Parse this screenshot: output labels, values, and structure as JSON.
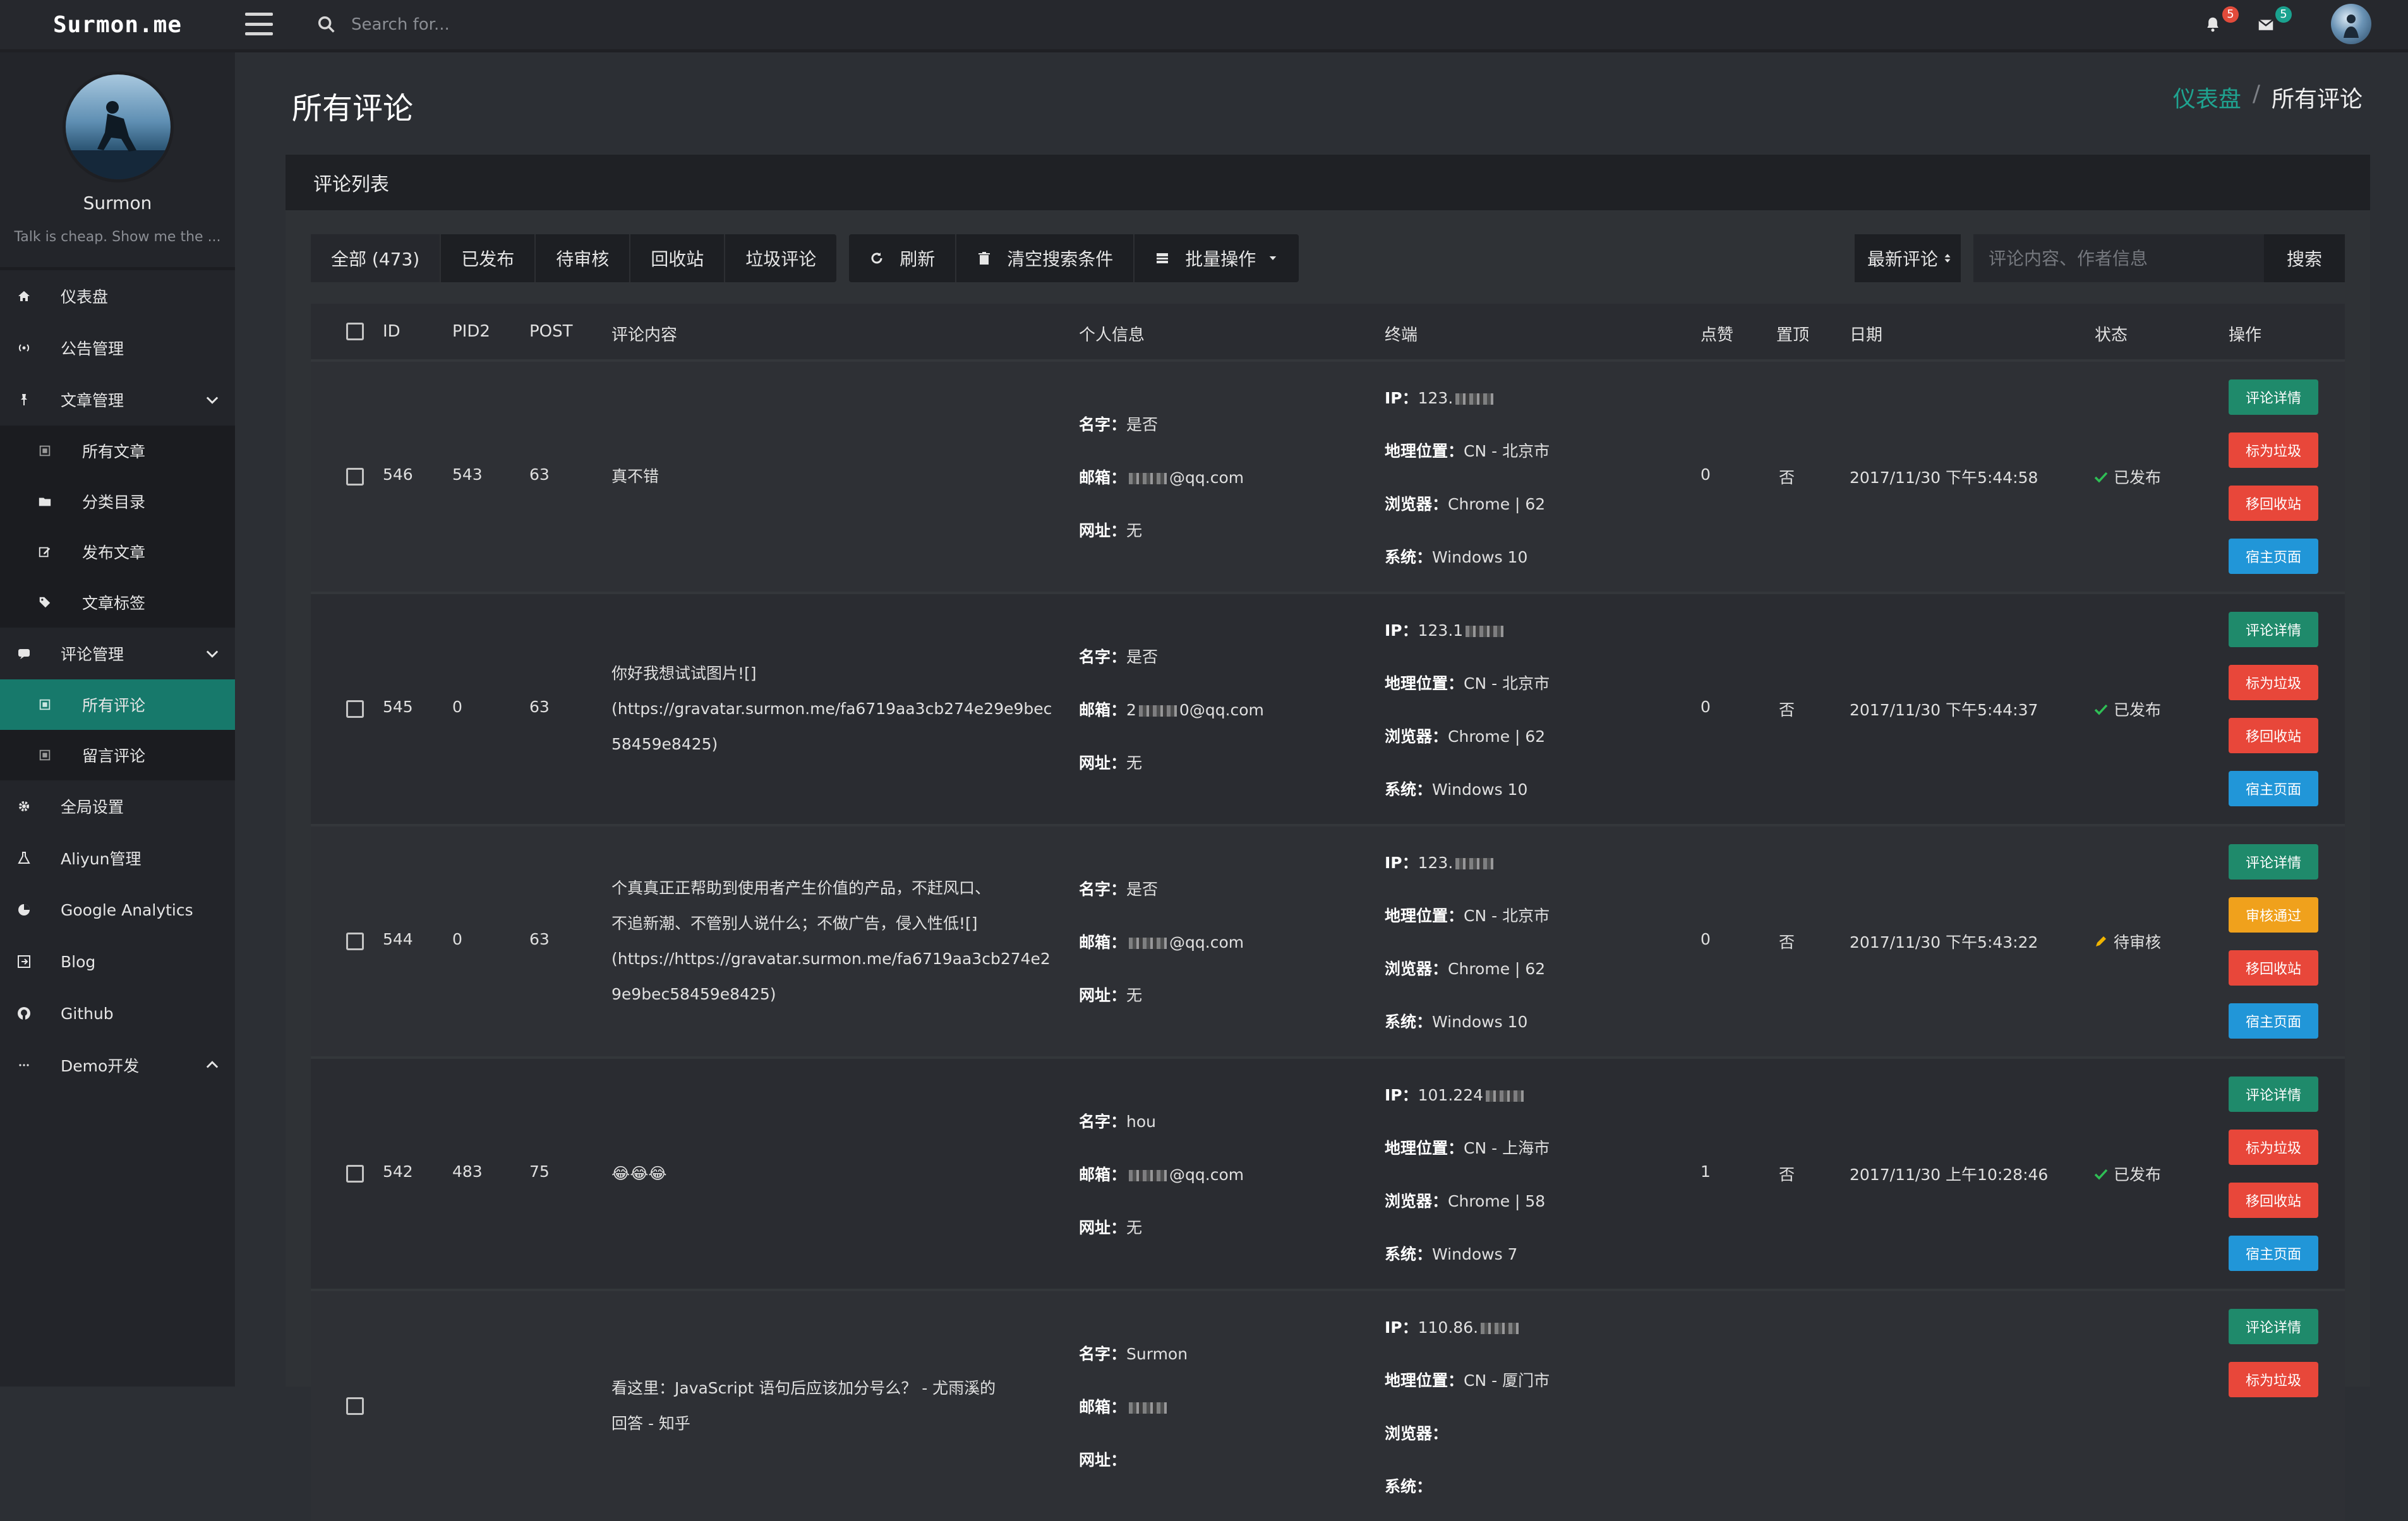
{
  "topbar": {
    "brand": "Surmon.me",
    "search_placeholder": "Search for...",
    "notification_count": "5",
    "message_count": "5"
  },
  "sidebar": {
    "profile": {
      "name": "Surmon",
      "motto": "Talk is cheap. Show me the ..."
    },
    "items": [
      {
        "label": "仪表盘",
        "icon": "home-icon"
      },
      {
        "label": "公告管理",
        "icon": "broadcast-icon"
      },
      {
        "label": "文章管理",
        "icon": "pin-icon",
        "expanded": true,
        "children": [
          {
            "label": "所有文章",
            "icon": "list-icon"
          },
          {
            "label": "分类目录",
            "icon": "folder-icon"
          },
          {
            "label": "发布文章",
            "icon": "edit-icon"
          },
          {
            "label": "文章标签",
            "icon": "tag-icon"
          }
        ]
      },
      {
        "label": "评论管理",
        "icon": "comment-icon",
        "expanded": true,
        "children": [
          {
            "label": "所有评论",
            "icon": "list-icon",
            "active": true
          },
          {
            "label": "留言评论",
            "icon": "list-icon"
          }
        ]
      },
      {
        "label": "全局设置",
        "icon": "gear-icon"
      },
      {
        "label": "Aliyun管理",
        "icon": "flask-icon"
      },
      {
        "label": "Google Analytics",
        "icon": "pie-chart-icon"
      },
      {
        "label": "Blog",
        "icon": "external-link-icon"
      },
      {
        "label": "Github",
        "icon": "github-icon"
      },
      {
        "label": "Demo开发",
        "icon": "ellipsis-icon"
      }
    ]
  },
  "page": {
    "title": "所有评论",
    "breadcrumb": {
      "home": "仪表盘",
      "current": "所有评论"
    }
  },
  "panel": {
    "title": "评论列表",
    "filters": [
      "全部 (473)",
      "已发布",
      "待审核",
      "回收站",
      "垃圾评论"
    ],
    "actions": {
      "refresh": "刷新",
      "clear": "清空搜索条件",
      "batch": "批量操作"
    },
    "sort_label": "最新评论",
    "keyword_placeholder": "评论内容、作者信息",
    "search_label": "搜索"
  },
  "table": {
    "headers": {
      "id": "ID",
      "pid": "PID2",
      "post": "POST",
      "content": "评论内容",
      "info": "个人信息",
      "terminal": "终端",
      "likes": "点赞",
      "top": "置顶",
      "date": "日期",
      "status": "状态",
      "ops": "操作"
    },
    "labels": {
      "name": "名字：",
      "email": "邮箱：",
      "site": "网址：",
      "ip": "IP：",
      "geo": "地理位置：",
      "browser": "浏览器：",
      "os": "系统："
    },
    "rows": [
      {
        "id": "546",
        "pid": "543",
        "post": "63",
        "content": [
          "真不错"
        ],
        "name": "是否",
        "email_pre": "",
        "email_suf": "@qq.com",
        "site": "无",
        "ip": "123.",
        "geo": "CN - 北京市",
        "browser": "Chrome | 62",
        "os": "Windows 10",
        "likes": "0",
        "top": "否",
        "date": "2017/11/30 下午5:44:58",
        "status": "已发布",
        "status_kind": "published",
        "ops": [
          {
            "label": "评论详情",
            "color": "green"
          },
          {
            "label": "标为垃圾",
            "color": "red"
          },
          {
            "label": "移回收站",
            "color": "red"
          },
          {
            "label": "宿主页面",
            "color": "blue"
          }
        ]
      },
      {
        "id": "545",
        "pid": "0",
        "post": "63",
        "content": [
          "你好我想试试图片![]",
          "(https://gravatar.surmon.me/fa6719aa3cb274e29e9bec",
          "58459e8425)"
        ],
        "name": "是否",
        "email_pre": "2",
        "email_suf": "0@qq.com",
        "site": "无",
        "ip": "123.1",
        "geo": "CN - 北京市",
        "browser": "Chrome | 62",
        "os": "Windows 10",
        "likes": "0",
        "top": "否",
        "date": "2017/11/30 下午5:44:37",
        "status": "已发布",
        "status_kind": "published",
        "ops": [
          {
            "label": "评论详情",
            "color": "green"
          },
          {
            "label": "标为垃圾",
            "color": "red"
          },
          {
            "label": "移回收站",
            "color": "red"
          },
          {
            "label": "宿主页面",
            "color": "blue"
          }
        ]
      },
      {
        "id": "544",
        "pid": "0",
        "post": "63",
        "content": [
          "个真真正正帮助到使用者产生价值的产品，不赶风口、",
          "不追新潮、不管别人说什么；不做广告，侵入性低![]",
          "(https://https://gravatar.surmon.me/fa6719aa3cb274e2",
          "9e9bec58459e8425)"
        ],
        "name": "是否",
        "email_pre": "",
        "email_suf": "@qq.com",
        "site": "无",
        "ip": "123.",
        "geo": "CN - 北京市",
        "browser": "Chrome | 62",
        "os": "Windows 10",
        "likes": "0",
        "top": "否",
        "date": "2017/11/30 下午5:43:22",
        "status": "待审核",
        "status_kind": "pending",
        "ops": [
          {
            "label": "评论详情",
            "color": "green"
          },
          {
            "label": "审核通过",
            "color": "orange"
          },
          {
            "label": "移回收站",
            "color": "red"
          },
          {
            "label": "宿主页面",
            "color": "blue"
          }
        ]
      },
      {
        "id": "542",
        "pid": "483",
        "post": "75",
        "content": [
          "😂😂😂"
        ],
        "name": "hou",
        "email_pre": "",
        "email_suf": "@qq.com",
        "site": "无",
        "ip": "101.224",
        "geo": "CN - 上海市",
        "browser": "Chrome | 58",
        "os": "Windows 7",
        "likes": "1",
        "top": "否",
        "date": "2017/11/30 上午10:28:46",
        "status": "已发布",
        "status_kind": "published",
        "ops": [
          {
            "label": "评论详情",
            "color": "green"
          },
          {
            "label": "标为垃圾",
            "color": "red"
          },
          {
            "label": "移回收站",
            "color": "red"
          },
          {
            "label": "宿主页面",
            "color": "blue"
          }
        ]
      },
      {
        "id": "",
        "pid": "",
        "post": "",
        "content": [
          "看这里：JavaScript 语句后应该加分号么？ - 尤雨溪的",
          "回答 - 知乎"
        ],
        "name": "Surmon",
        "email_pre": "",
        "email_suf": "",
        "site": "",
        "ip": "110.86.",
        "geo": "CN - 厦门市",
        "browser": "",
        "os": "",
        "likes": "",
        "top": "",
        "date": "",
        "status": "",
        "status_kind": "",
        "ops": [
          {
            "label": "评论详情",
            "color": "green"
          },
          {
            "label": "标为垃圾",
            "color": "red"
          }
        ]
      }
    ]
  },
  "colors": {
    "accent": "#17796b",
    "link": "#1fa390",
    "danger": "#e8473a",
    "warning": "#f0a11c",
    "info": "#2196d8",
    "success": "#1f8a6b"
  }
}
